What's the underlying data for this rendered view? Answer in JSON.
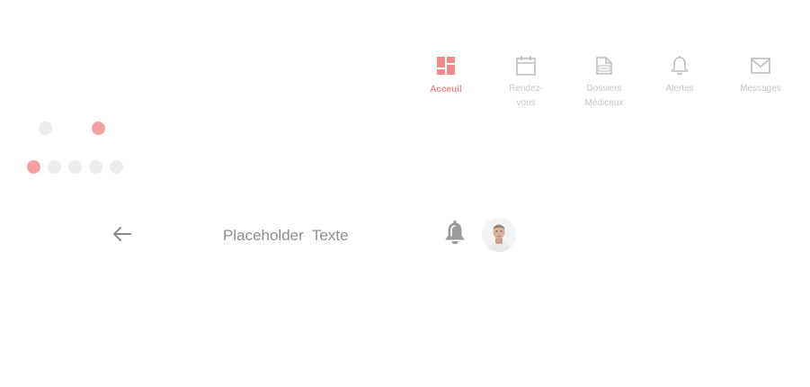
{
  "nav": {
    "items": [
      {
        "label": "Acceuil",
        "icon": "dashboard-icon"
      },
      {
        "label": "Rendez-\nvous",
        "icon": "calendar-icon"
      },
      {
        "label": "Dossiers\nMédicaux",
        "icon": "medical-folder-icon"
      },
      {
        "label": "Alertes",
        "icon": "bell-icon"
      },
      {
        "label": "Messages",
        "icon": "envelope-icon"
      }
    ],
    "active_index": 0
  },
  "dots": {
    "toggle_active_index": 1,
    "page_count": 5,
    "page_active_index": 0
  },
  "header": {
    "title": "Placeholder  Texte",
    "back_icon": "arrow-left-icon",
    "bell_icon": "bell-icon",
    "avatar_icon": "avatar"
  },
  "colors": {
    "accent": "#f28b8b",
    "dot_active": "#f4a1a1",
    "dot_inactive": "#ececec",
    "nav_inactive": "#c7c7c7",
    "text_gray": "#8e8e8e"
  }
}
